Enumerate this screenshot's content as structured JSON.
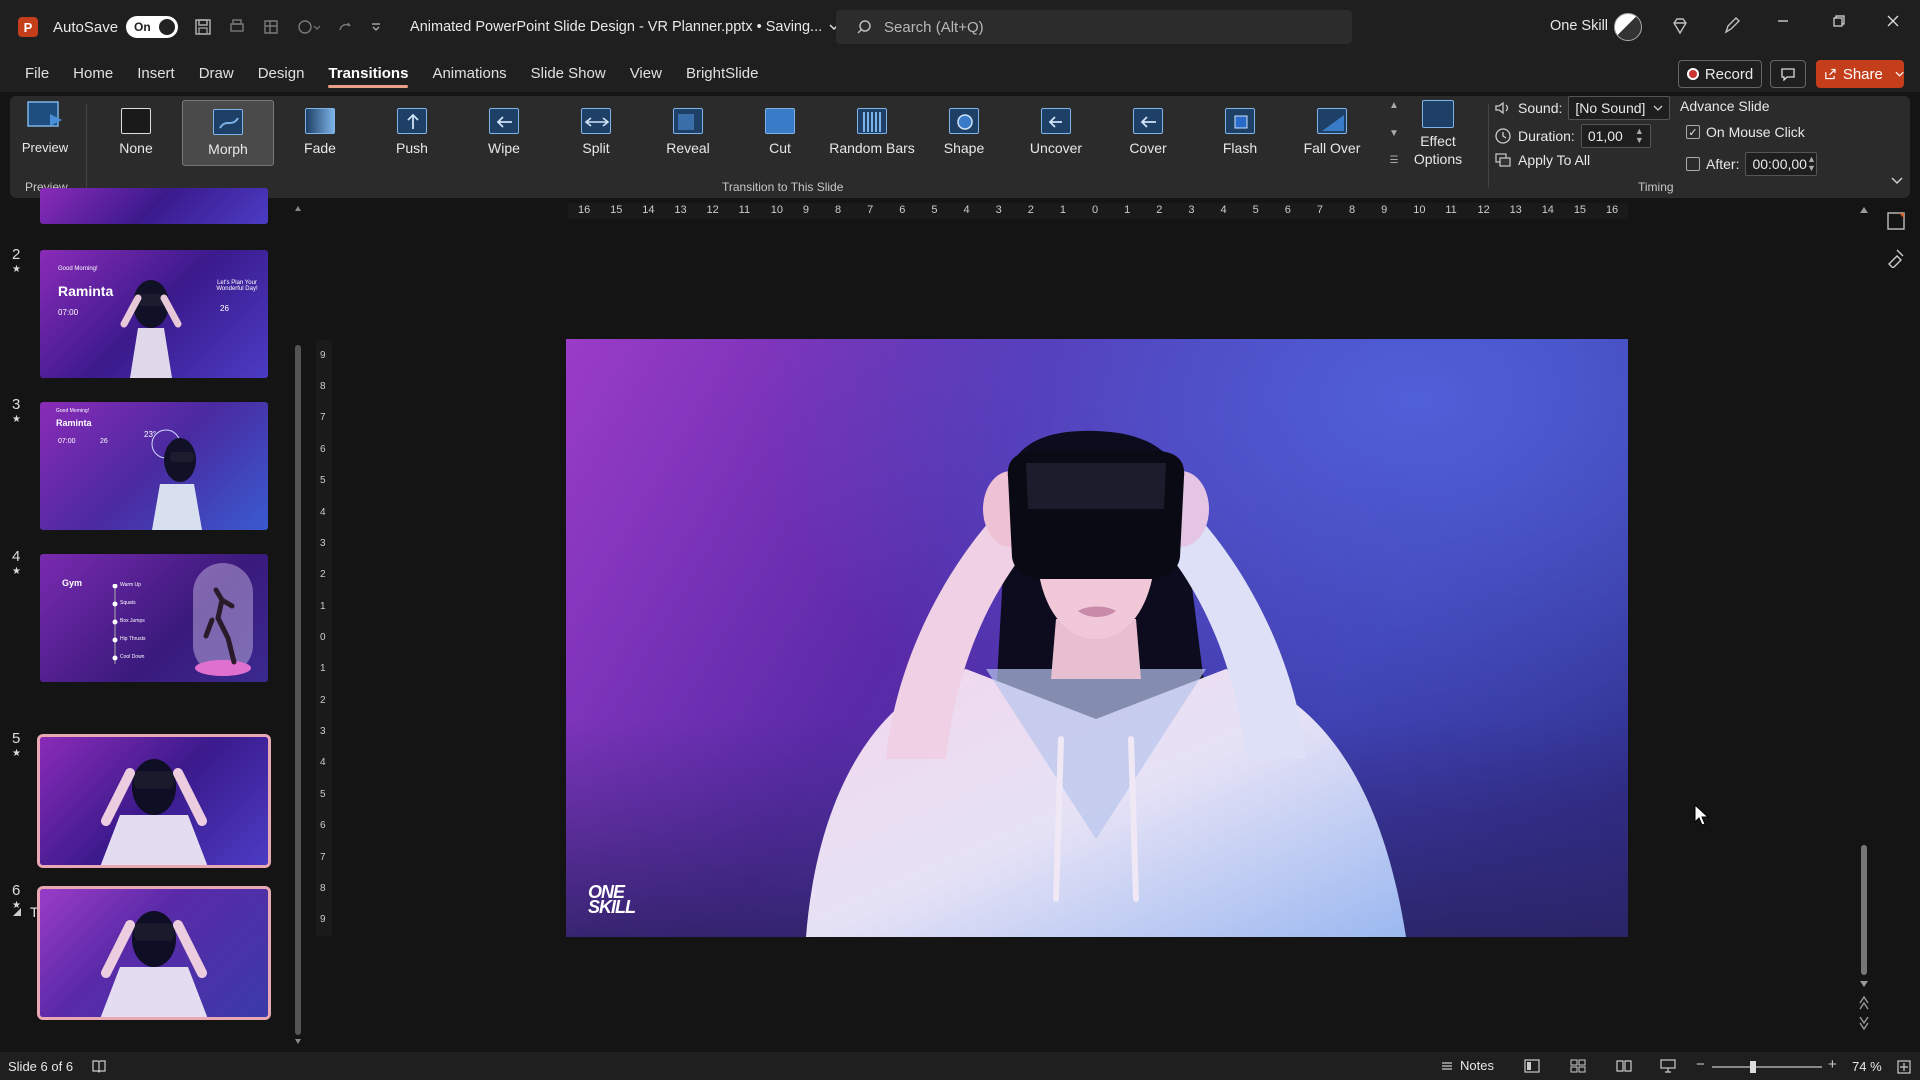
{
  "titlebar": {
    "autosave_label": "AutoSave",
    "autosave_state": "On",
    "document_title": "Animated PowerPoint Slide Design - VR Planner.pptx • Saving...",
    "search_placeholder": "Search (Alt+Q)",
    "user_name": "One Skill"
  },
  "tabs": [
    "File",
    "Home",
    "Insert",
    "Draw",
    "Design",
    "Transitions",
    "Animations",
    "Slide Show",
    "View",
    "BrightSlide"
  ],
  "active_tab": "Transitions",
  "header_buttons": {
    "record": "Record",
    "share": "Share"
  },
  "ribbon": {
    "preview_label": "Preview",
    "preview_group": "Preview",
    "transitions": [
      "None",
      "Morph",
      "Fade",
      "Push",
      "Wipe",
      "Split",
      "Reveal",
      "Cut",
      "Random Bars",
      "Shape",
      "Uncover",
      "Cover",
      "Flash",
      "Fall Over"
    ],
    "selected_transition": "Morph",
    "transitions_group": "Transition to This Slide",
    "effect_options": "Effect Options",
    "sound_label": "Sound:",
    "sound_value": "[No Sound]",
    "duration_label": "Duration:",
    "duration_value": "01,00",
    "apply_all": "Apply To All",
    "advance_title": "Advance Slide",
    "on_mouse_click": "On Mouse Click",
    "on_mouse_click_checked": true,
    "after_label": "After:",
    "after_value": "00:00,00",
    "after_checked": false,
    "timing_group": "Timing"
  },
  "slides_panel": {
    "section_name": "Tutorial",
    "slides": [
      {
        "number": "2",
        "title": "Raminta",
        "greeting": "Good Morning!",
        "tagline": "Let's Plan Your Wonderful Day!",
        "time": "07:00",
        "day": "26"
      },
      {
        "number": "3",
        "title": "Raminta",
        "greeting": "Good Morning!",
        "time": "07:00",
        "day": "26",
        "temp": "23°"
      },
      {
        "number": "4",
        "title": "Gym",
        "items": [
          "Warm Up",
          "Squats",
          "Box Jumps",
          "Hip Thrusts",
          "Cool Down"
        ]
      },
      {
        "number": "5"
      },
      {
        "number": "6"
      }
    ]
  },
  "ruler": {
    "horizontal": [
      "16",
      "15",
      "14",
      "13",
      "12",
      "11",
      "10",
      "9",
      "8",
      "7",
      "6",
      "5",
      "4",
      "3",
      "2",
      "1",
      "0",
      "1",
      "2",
      "3",
      "4",
      "5",
      "6",
      "7",
      "8",
      "9",
      "10",
      "11",
      "12",
      "13",
      "14",
      "15",
      "16"
    ],
    "vertical": [
      "9",
      "8",
      "7",
      "6",
      "5",
      "4",
      "3",
      "2",
      "1",
      "0",
      "1",
      "2",
      "3",
      "4",
      "5",
      "6",
      "7",
      "8",
      "9"
    ]
  },
  "slide": {
    "logo_line1": "ONE",
    "logo_line2": "SKILL"
  },
  "statusbar": {
    "slide_info": "Slide 6 of 6",
    "notes": "Notes",
    "zoom": "74 %"
  },
  "colors": {
    "accent": "#c43e1c",
    "tab_underline": "#e8a08a",
    "selection_border": "#e8a8b4",
    "slide_purple": "#9a3cc8",
    "slide_blue": "#3a3aa8"
  }
}
